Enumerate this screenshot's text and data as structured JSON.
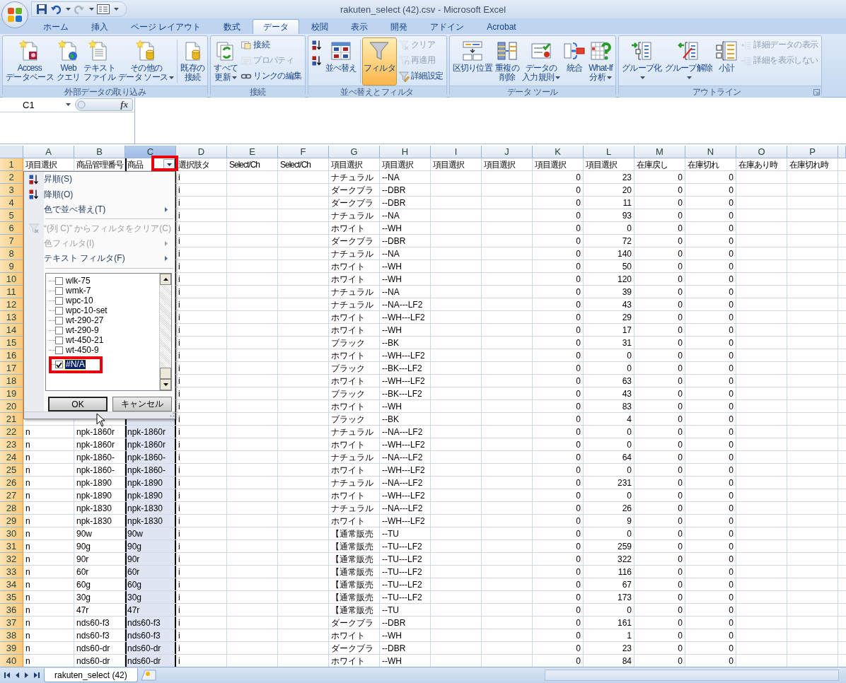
{
  "window": {
    "title": "rakuten_select (42).csv - Microsoft Excel"
  },
  "ribbon": {
    "tabs": [
      {
        "label": "ホーム",
        "selected": false
      },
      {
        "label": "挿入",
        "selected": false
      },
      {
        "label": "ページ レイアウト",
        "selected": false
      },
      {
        "label": "数式",
        "selected": false
      },
      {
        "label": "データ",
        "selected": true
      },
      {
        "label": "校閲",
        "selected": false
      },
      {
        "label": "表示",
        "selected": false
      },
      {
        "label": "開発",
        "selected": false
      },
      {
        "label": "アドイン",
        "selected": false
      },
      {
        "label": "Acrobat",
        "selected": false
      }
    ],
    "groups": [
      {
        "label": "外部データの取り込み",
        "launcher": false,
        "controls": [
          {
            "kind": "large",
            "lines": [
              "Access",
              "データベース"
            ],
            "active": false
          },
          {
            "kind": "large",
            "lines": [
              "Web",
              "クエリ"
            ],
            "active": false
          },
          {
            "kind": "large",
            "lines": [
              "テキスト",
              "ファイル"
            ],
            "active": false
          },
          {
            "kind": "large",
            "lines": [
              "その他の",
              "データ ソース"
            ],
            "dropdown": true,
            "active": false
          },
          {
            "kind": "separator"
          },
          {
            "kind": "large",
            "lines": [
              "既存の",
              "接続"
            ],
            "active": false
          }
        ]
      },
      {
        "label": "接続",
        "launcher": false,
        "controls": [
          {
            "kind": "large",
            "lines": [
              "すべて",
              "更新"
            ],
            "dropdown": true,
            "active": false
          },
          {
            "kind": "stack",
            "items": [
              {
                "label": "接続",
                "disabled": false
              },
              {
                "label": "プロパティ",
                "disabled": true
              },
              {
                "label": "リンクの編集",
                "disabled": false
              }
            ]
          }
        ]
      },
      {
        "label": "並べ替えとフィルタ",
        "launcher": false,
        "controls": [
          {
            "kind": "stack",
            "items": [
              {
                "disabled": false
              },
              {
                "disabled": false
              }
            ]
          },
          {
            "kind": "large",
            "lines": [
              "並べ替え"
            ],
            "active": false
          },
          {
            "kind": "separator"
          },
          {
            "kind": "large",
            "lines": [
              "フィルタ"
            ],
            "active": true
          },
          {
            "kind": "stack",
            "items": [
              {
                "label": "クリア",
                "disabled": true
              },
              {
                "label": "再適用",
                "disabled": true
              },
              {
                "label": "詳細設定",
                "disabled": false
              }
            ]
          }
        ]
      },
      {
        "label": "データ ツール",
        "launcher": false,
        "controls": [
          {
            "kind": "large",
            "lines": [
              "区切り位置"
            ],
            "active": false
          },
          {
            "kind": "large",
            "lines": [
              "重複の",
              "削除"
            ],
            "active": false
          },
          {
            "kind": "large",
            "lines": [
              "データの",
              "入力規則"
            ],
            "dropdown": true,
            "active": false
          },
          {
            "kind": "large",
            "lines": [
              "統合"
            ],
            "active": false
          },
          {
            "kind": "large",
            "lines": [
              "What-If",
              "分析"
            ],
            "dropdown": true,
            "active": false
          }
        ]
      },
      {
        "label": "アウトライン",
        "launcher": true,
        "controls": [
          {
            "kind": "large",
            "lines": [
              "グループ化"
            ],
            "dropdown": true,
            "active": false
          },
          {
            "kind": "large",
            "lines": [
              "グループ解除"
            ],
            "dropdown": true,
            "active": false
          },
          {
            "kind": "large",
            "lines": [
              "小計"
            ],
            "active": false
          },
          {
            "kind": "stack",
            "items": [
              {
                "label": "詳細データの表示",
                "disabled": true
              },
              {
                "label": "詳細を表示しない",
                "disabled": true
              }
            ]
          }
        ]
      }
    ]
  },
  "formula_bar": {
    "name_box": "C1",
    "fx": "fx"
  },
  "sheet": {
    "columns": [
      {
        "label": "A",
        "selected": false
      },
      {
        "label": "B",
        "selected": false
      },
      {
        "label": "C",
        "selected": true,
        "filter": true
      },
      {
        "label": "D",
        "selected": false
      },
      {
        "label": "E",
        "selected": false
      },
      {
        "label": "F",
        "selected": false
      },
      {
        "label": "G",
        "selected": false
      },
      {
        "label": "H",
        "selected": false
      },
      {
        "label": "I",
        "selected": false
      },
      {
        "label": "J",
        "selected": false
      },
      {
        "label": "K",
        "selected": false
      },
      {
        "label": "L",
        "selected": false
      },
      {
        "label": "M",
        "selected": false
      },
      {
        "label": "N",
        "selected": false
      },
      {
        "label": "O",
        "selected": false
      },
      {
        "label": "P",
        "selected": false
      }
    ],
    "rows": [
      {
        "n": "1",
        "kind": "header",
        "cells": {
          "A": "項目選択",
          "B": "商品管理番号",
          "C": "商品",
          "D": "選択肢タ",
          "E": "Select/Ch",
          "F": "Select/Ch",
          "G": "項目選択",
          "H": "項目選択",
          "I": "項目選択",
          "J": "項目選択",
          "K": "項目選択",
          "L": "項目選択",
          "M": "在庫戻し",
          "N": "在庫切れ",
          "O": "在庫あり時",
          "P": "在庫切れ時"
        }
      },
      {
        "n": "2",
        "kind": "data",
        "cells": {
          "D": "i",
          "G": "ナチュラル",
          "H": "--NA",
          "K": "0",
          "L": "23",
          "M": "0",
          "N": "0"
        }
      },
      {
        "n": "3",
        "kind": "data",
        "cells": {
          "D": "i",
          "G": "ダークブラ",
          "H": "--DBR",
          "K": "0",
          "L": "20",
          "M": "0",
          "N": "0"
        }
      },
      {
        "n": "4",
        "kind": "data",
        "cells": {
          "D": "i",
          "G": "ダークブラ",
          "H": "--DBR",
          "K": "0",
          "L": "11",
          "M": "0",
          "N": "0"
        }
      },
      {
        "n": "5",
        "kind": "data",
        "cells": {
          "D": "i",
          "G": "ナチュラル",
          "H": "--NA",
          "K": "0",
          "L": "93",
          "M": "0",
          "N": "0"
        }
      },
      {
        "n": "6",
        "kind": "data",
        "cells": {
          "D": "i",
          "G": "ホワイト",
          "H": "--WH",
          "K": "0",
          "L": "0",
          "M": "0",
          "N": "0"
        }
      },
      {
        "n": "7",
        "kind": "data",
        "cells": {
          "D": "i",
          "G": "ダークブラ",
          "H": "--DBR",
          "K": "0",
          "L": "72",
          "M": "0",
          "N": "0"
        }
      },
      {
        "n": "8",
        "kind": "data",
        "cells": {
          "D": "i",
          "G": "ナチュラル",
          "H": "--NA",
          "K": "0",
          "L": "140",
          "M": "0",
          "N": "0"
        }
      },
      {
        "n": "9",
        "kind": "data",
        "cells": {
          "D": "i",
          "G": "ホワイト",
          "H": "--WH",
          "K": "0",
          "L": "50",
          "M": "0",
          "N": "0"
        }
      },
      {
        "n": "10",
        "kind": "data",
        "cells": {
          "D": "i",
          "G": "ホワイト",
          "H": "--WH",
          "K": "0",
          "L": "120",
          "M": "0",
          "N": "0"
        }
      },
      {
        "n": "11",
        "kind": "data",
        "cells": {
          "D": "i",
          "G": "ナチュラル",
          "H": "--NA",
          "K": "0",
          "L": "39",
          "M": "0",
          "N": "0"
        }
      },
      {
        "n": "12",
        "kind": "data",
        "cells": {
          "D": "i",
          "G": "ナチュラル",
          "H": "--NA---LF2",
          "K": "0",
          "L": "43",
          "M": "0",
          "N": "0"
        }
      },
      {
        "n": "13",
        "kind": "data",
        "cells": {
          "D": "i",
          "G": "ホワイト",
          "H": "--WH---LF2",
          "K": "0",
          "L": "29",
          "M": "0",
          "N": "0"
        }
      },
      {
        "n": "14",
        "kind": "data",
        "cells": {
          "D": "i",
          "G": "ホワイト",
          "H": "--WH",
          "K": "0",
          "L": "17",
          "M": "0",
          "N": "0"
        }
      },
      {
        "n": "15",
        "kind": "data",
        "cells": {
          "D": "i",
          "G": "ブラック",
          "H": "--BK",
          "K": "0",
          "L": "31",
          "M": "0",
          "N": "0"
        }
      },
      {
        "n": "16",
        "kind": "data",
        "cells": {
          "D": "i",
          "G": "ホワイト",
          "H": "--WH---LF2",
          "K": "0",
          "L": "0",
          "M": "0",
          "N": "0"
        }
      },
      {
        "n": "17",
        "kind": "data",
        "cells": {
          "D": "i",
          "G": "ブラック",
          "H": "--BK---LF2",
          "K": "0",
          "L": "0",
          "M": "0",
          "N": "0"
        }
      },
      {
        "n": "18",
        "kind": "data",
        "cells": {
          "D": "i",
          "G": "ホワイト",
          "H": "--WH---LF2",
          "K": "0",
          "L": "63",
          "M": "0",
          "N": "0"
        }
      },
      {
        "n": "19",
        "kind": "data",
        "cells": {
          "D": "i",
          "G": "ブラック",
          "H": "--BK---LF2",
          "K": "0",
          "L": "43",
          "M": "0",
          "N": "0"
        }
      },
      {
        "n": "20",
        "kind": "data",
        "cells": {
          "D": "i",
          "G": "ホワイト",
          "H": "--WH",
          "K": "0",
          "L": "83",
          "M": "0",
          "N": "0"
        }
      },
      {
        "n": "21",
        "kind": "data",
        "cells": {
          "D": "i",
          "G": "ブラック",
          "H": "--BK",
          "K": "0",
          "L": "4",
          "M": "0",
          "N": "0"
        }
      },
      {
        "n": "22",
        "kind": "data",
        "cells": {
          "A": "n",
          "B": "npk-1860r",
          "C": "npk-1860r",
          "D": "i",
          "G": "ナチュラル",
          "H": "--NA---LF2",
          "K": "0",
          "L": "0",
          "M": "0",
          "N": "0"
        }
      },
      {
        "n": "23",
        "kind": "data",
        "cells": {
          "A": "n",
          "B": "npk-1860r",
          "C": "npk-1860r",
          "D": "i",
          "G": "ホワイト",
          "H": "--WH---LF2",
          "K": "0",
          "L": "0",
          "M": "0",
          "N": "0"
        }
      },
      {
        "n": "24",
        "kind": "data",
        "cells": {
          "A": "n",
          "B": "npk-1860-",
          "C": "npk-1860-",
          "D": "i",
          "G": "ナチュラル",
          "H": "--NA---LF2",
          "K": "0",
          "L": "64",
          "M": "0",
          "N": "0"
        }
      },
      {
        "n": "25",
        "kind": "data",
        "cells": {
          "A": "n",
          "B": "npk-1860-",
          "C": "npk-1860-",
          "D": "i",
          "G": "ホワイト",
          "H": "--WH---LF2",
          "K": "0",
          "L": "0",
          "M": "0",
          "N": "0"
        }
      },
      {
        "n": "26",
        "kind": "data",
        "cells": {
          "A": "n",
          "B": "npk-1890",
          "C": "npk-1890",
          "D": "i",
          "G": "ナチュラル",
          "H": "--NA---LF2",
          "K": "0",
          "L": "231",
          "M": "0",
          "N": "0"
        }
      },
      {
        "n": "27",
        "kind": "data",
        "cells": {
          "A": "n",
          "B": "npk-1890",
          "C": "npk-1890",
          "D": "i",
          "G": "ホワイト",
          "H": "--WH---LF2",
          "K": "0",
          "L": "0",
          "M": "0",
          "N": "0"
        }
      },
      {
        "n": "28",
        "kind": "data",
        "cells": {
          "A": "n",
          "B": "npk-1830",
          "C": "npk-1830",
          "D": "i",
          "G": "ナチュラル",
          "H": "--NA---LF2",
          "K": "0",
          "L": "26",
          "M": "0",
          "N": "0"
        }
      },
      {
        "n": "29",
        "kind": "data",
        "cells": {
          "A": "n",
          "B": "npk-1830",
          "C": "npk-1830",
          "D": "i",
          "G": "ホワイト",
          "H": "--WH---LF2",
          "K": "0",
          "L": "9",
          "M": "0",
          "N": "0"
        }
      },
      {
        "n": "30",
        "kind": "data",
        "cells": {
          "A": "n",
          "B": "90w",
          "C": "90w",
          "D": "i",
          "G": "【通常販売",
          "H": "--TU",
          "K": "0",
          "L": "0",
          "M": "0",
          "N": "0"
        }
      },
      {
        "n": "31",
        "kind": "data",
        "cells": {
          "A": "n",
          "B": "90g",
          "C": "90g",
          "D": "i",
          "G": "【通常販売",
          "H": "--TU---LF2",
          "K": "0",
          "L": "259",
          "M": "0",
          "N": "0"
        }
      },
      {
        "n": "32",
        "kind": "data",
        "cells": {
          "A": "n",
          "B": "90r",
          "C": "90r",
          "D": "i",
          "G": "【通常販売",
          "H": "--TU---LF2",
          "K": "0",
          "L": "322",
          "M": "0",
          "N": "0"
        }
      },
      {
        "n": "33",
        "kind": "data",
        "cells": {
          "A": "n",
          "B": "60r",
          "C": "60r",
          "D": "i",
          "G": "【通常販売",
          "H": "--TU---LF2",
          "K": "0",
          "L": "116",
          "M": "0",
          "N": "0"
        }
      },
      {
        "n": "34",
        "kind": "data",
        "cells": {
          "A": "n",
          "B": "60g",
          "C": "60g",
          "D": "i",
          "G": "【通常販売",
          "H": "--TU---LF2",
          "K": "0",
          "L": "67",
          "M": "0",
          "N": "0"
        }
      },
      {
        "n": "35",
        "kind": "data",
        "cells": {
          "A": "n",
          "B": "30g",
          "C": "30g",
          "D": "i",
          "G": "【通常販売",
          "H": "--TU---LF2",
          "K": "0",
          "L": "173",
          "M": "0",
          "N": "0"
        }
      },
      {
        "n": "36",
        "kind": "data",
        "cells": {
          "A": "n",
          "B": "47r",
          "C": "47r",
          "D": "i",
          "G": "【通常販売",
          "H": "--TU",
          "K": "0",
          "L": "0",
          "M": "0",
          "N": "0"
        }
      },
      {
        "n": "37",
        "kind": "data",
        "cells": {
          "A": "n",
          "B": "nds60-f3",
          "C": "nds60-f3",
          "D": "i",
          "G": "ダークブラ",
          "H": "--DBR",
          "K": "0",
          "L": "161",
          "M": "0",
          "N": "0"
        }
      },
      {
        "n": "38",
        "kind": "data",
        "cells": {
          "A": "n",
          "B": "nds60-f3",
          "C": "nds60-f3",
          "D": "i",
          "G": "ホワイト",
          "H": "--WH",
          "K": "0",
          "L": "1",
          "M": "0",
          "N": "0"
        }
      },
      {
        "n": "39",
        "kind": "data",
        "cells": {
          "A": "n",
          "B": "nds60-dr",
          "C": "nds60-dr",
          "D": "i",
          "G": "ダークブラ",
          "H": "--DBR",
          "K": "0",
          "L": "23",
          "M": "0",
          "N": "0"
        }
      },
      {
        "n": "40",
        "kind": "data",
        "cells": {
          "A": "n",
          "B": "nds60-dr",
          "C": "nds60-dr",
          "D": "i",
          "G": "ホワイト",
          "H": "--WH",
          "K": "0",
          "L": "84",
          "M": "0",
          "N": "0"
        }
      }
    ]
  },
  "filter_menu": {
    "items": [
      {
        "kind": "sort-asc",
        "label": "昇順(S)",
        "disabled": false
      },
      {
        "kind": "sort-desc",
        "label": "降順(O)",
        "disabled": false
      },
      {
        "kind": "submenu",
        "label": "色で並べ替え(T)",
        "disabled": false
      },
      {
        "kind": "separator"
      },
      {
        "kind": "clear",
        "label": "“(列 C)” からフィルタをクリア(C)",
        "disabled": true
      },
      {
        "kind": "submenu",
        "label": "色フィルタ(I)",
        "disabled": true
      },
      {
        "kind": "submenu",
        "label": "テキスト フィルタ(F)",
        "disabled": false
      }
    ],
    "values": [
      {
        "label": "wlk-75",
        "checked": false,
        "selected": false
      },
      {
        "label": "wmk-7",
        "checked": false,
        "selected": false
      },
      {
        "label": "wpc-10",
        "checked": false,
        "selected": false
      },
      {
        "label": "wpc-10-set",
        "checked": false,
        "selected": false
      },
      {
        "label": "wt-290-27",
        "checked": false,
        "selected": false
      },
      {
        "label": "wt-290-9",
        "checked": false,
        "selected": false
      },
      {
        "label": "wt-450-21",
        "checked": false,
        "selected": false
      },
      {
        "label": "wt-450-9",
        "checked": false,
        "selected": false
      },
      {
        "label": "#N/A",
        "checked": true,
        "selected": true
      }
    ],
    "buttons": [
      "OK",
      "キャンセル"
    ]
  },
  "sheet_tabs": [
    {
      "label": "rakuten_select (42)",
      "selected": true
    }
  ]
}
